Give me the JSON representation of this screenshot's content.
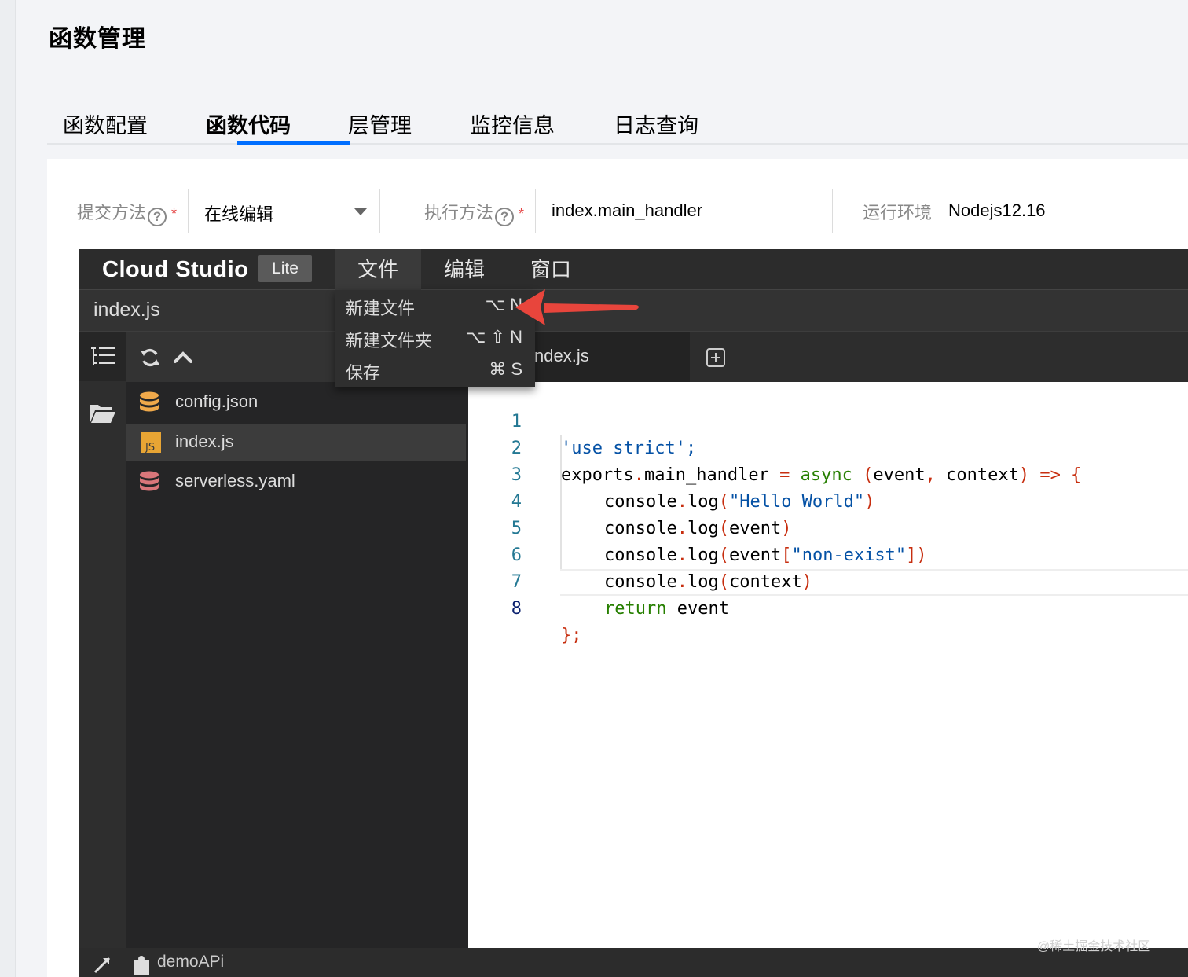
{
  "page": {
    "title": "函数管理",
    "watermark": "@稀土掘金技术社区"
  },
  "tabs": [
    {
      "label": "函数配置",
      "active": false
    },
    {
      "label": "函数代码",
      "active": true
    },
    {
      "label": "层管理",
      "active": false
    },
    {
      "label": "监控信息",
      "active": false
    },
    {
      "label": "日志查询",
      "active": false
    }
  ],
  "form": {
    "submit_method_label": "提交方法",
    "submit_method_value": "在线编辑",
    "handler_label": "执行方法",
    "handler_value": "index.main_handler",
    "runtime_label": "运行环境",
    "runtime_value": "Nodejs12.16",
    "required_mark": "*",
    "help_glyph": "?"
  },
  "ide": {
    "brand": "Cloud Studio",
    "badge": "Lite",
    "menus": [
      {
        "label": "文件",
        "open": true
      },
      {
        "label": "编辑",
        "open": false
      },
      {
        "label": "窗口",
        "open": false
      }
    ],
    "current_file": "index.js",
    "file_menu": [
      {
        "label": "新建文件",
        "shortcut": "⌥ N"
      },
      {
        "label": "新建文件夹",
        "shortcut": "⌥ ⇧ N"
      },
      {
        "label": "保存",
        "shortcut": "⌘ S"
      }
    ],
    "explorer_files": [
      {
        "name": "config.json",
        "icon": "database-icon",
        "selected": false
      },
      {
        "name": "index.js",
        "icon": "js-file-icon",
        "selected": true
      },
      {
        "name": "serverless.yaml",
        "icon": "database-icon",
        "selected": false
      }
    ],
    "editor_tab": "ndex.js",
    "status_project": "demoAPi",
    "line_numbers": [
      "1",
      "2",
      "3",
      "4",
      "5",
      "6",
      "7",
      "8"
    ],
    "current_line": 8,
    "code": {
      "l1": "'use strict';",
      "l2_a": "exports",
      "l2_b": ".",
      "l2_c": "main_handler ",
      "l2_d": "=",
      "l2_e": " async ",
      "l2_f": "(",
      "l2_g": "event",
      "l2_h": ",",
      "l2_i": " context",
      "l2_j": ")",
      "l2_k": " => {",
      "l3_a": "console",
      "l3_b": ".",
      "l3_c": "log",
      "l3_d": "(",
      "l3_e": "\"Hello World\"",
      "l3_f": ")",
      "l4_a": "console",
      "l4_b": ".",
      "l4_c": "log",
      "l4_d": "(",
      "l4_e": "event",
      "l4_f": ")",
      "l5_a": "console",
      "l5_b": ".",
      "l5_c": "log",
      "l5_d": "(",
      "l5_e": "event",
      "l5_f": "[",
      "l5_g": "\"non-exist\"",
      "l5_h": "])",
      "l6_a": "console",
      "l6_b": ".",
      "l6_c": "log",
      "l6_d": "(",
      "l6_e": "context",
      "l6_f": ")",
      "l7_a": "return",
      "l7_b": " event",
      "l8": "};"
    }
  },
  "colors": {
    "accent": "#006eff",
    "arrow": "#e8453c",
    "ide_bg": "#333333",
    "explorer_bg": "#252526"
  }
}
